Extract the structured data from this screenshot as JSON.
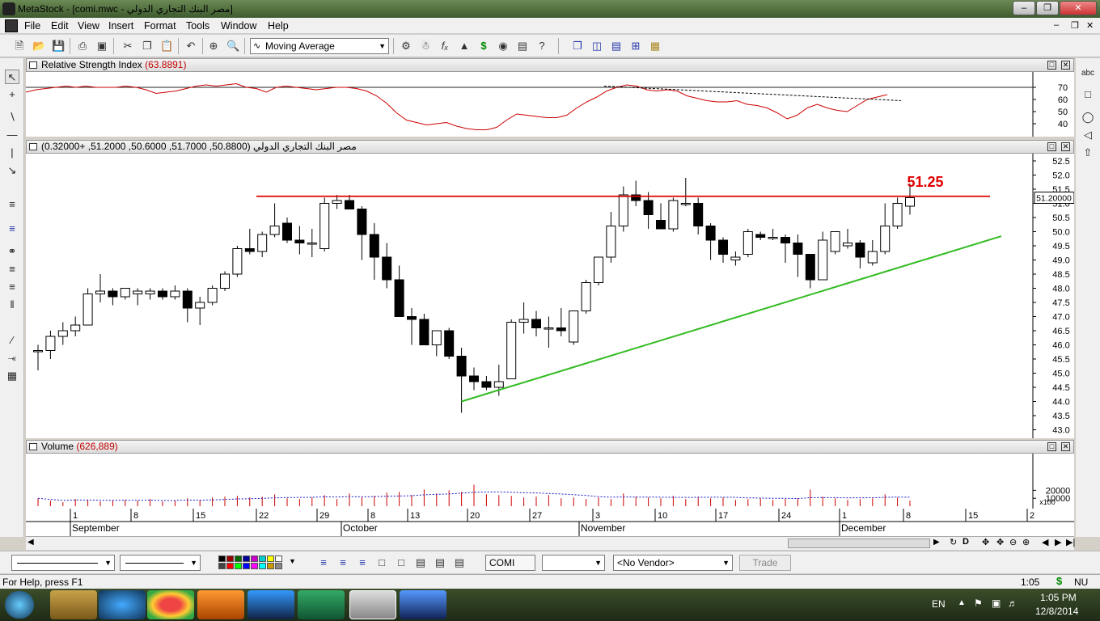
{
  "window": {
    "app_title": "MetaStock - [comi.mwc - مصر  البنك التجاري الدولي]"
  },
  "menu": [
    "File",
    "Edit",
    "View",
    "Insert",
    "Format",
    "Tools",
    "Window",
    "Help"
  ],
  "toolbar": {
    "indicator_select": "Moving Average",
    "icons": [
      "new-icon",
      "open-icon",
      "save-icon",
      "print-icon",
      "print-preview-icon",
      "cut-icon",
      "copy-icon",
      "paste-icon",
      "undo-icon",
      "crosshair-icon",
      "zoom-icon"
    ]
  },
  "rsi_panel": {
    "title": "Relative Strength Index",
    "value": "(63.8891)",
    "ticks": [
      "70",
      "60",
      "50",
      "40"
    ],
    "series_values": [
      66,
      68,
      69,
      70,
      71,
      70,
      71,
      70,
      70,
      70,
      71,
      70,
      68,
      65,
      66,
      67,
      69,
      71,
      72,
      71,
      72,
      73,
      70,
      69,
      66,
      70,
      71,
      70,
      69,
      68,
      69,
      70,
      70,
      69,
      67,
      63,
      57,
      49,
      43,
      41,
      39,
      40,
      41,
      38,
      36,
      35,
      35,
      37,
      43,
      48,
      47,
      46,
      45,
      45,
      47,
      53,
      58,
      62,
      67,
      70,
      72,
      71,
      68,
      67,
      68,
      67,
      63,
      61,
      59,
      58,
      58,
      59,
      56,
      55,
      53,
      49,
      44,
      47,
      53,
      56,
      53,
      51,
      50,
      55,
      60,
      62,
      64
    ]
  },
  "price_panel": {
    "title": "مصر  البنك التجاري الدولي",
    "ohlc_text": "(50.8800, 51.7000, 50.6000, 51.2000, +0.32000)",
    "current_price": "51.20000",
    "resistance_label": "51.25",
    "ticks": [
      "52.5",
      "52.0",
      "51.5",
      "51.0",
      "50.5",
      "50.0",
      "49.5",
      "49.0",
      "48.5",
      "48.0",
      "47.5",
      "47.0",
      "46.5",
      "46.0",
      "45.5",
      "45.0",
      "44.5",
      "44.0",
      "43.5",
      "43.0"
    ],
    "candles": [
      [
        45.8,
        46.0,
        45.1,
        45.8
      ],
      [
        45.8,
        46.5,
        45.5,
        46.3
      ],
      [
        46.3,
        46.8,
        46.0,
        46.5
      ],
      [
        46.5,
        47.0,
        46.3,
        46.7
      ],
      [
        46.7,
        48.0,
        46.7,
        47.8
      ],
      [
        47.8,
        48.5,
        47.5,
        47.9
      ],
      [
        47.9,
        48.0,
        47.4,
        47.7
      ],
      [
        47.7,
        48.0,
        47.6,
        48.0
      ],
      [
        47.8,
        48.0,
        47.4,
        47.9
      ],
      [
        47.8,
        48.0,
        47.6,
        47.9
      ],
      [
        47.9,
        48.0,
        47.6,
        47.7
      ],
      [
        47.7,
        48.1,
        47.6,
        47.9
      ],
      [
        47.9,
        48.0,
        46.8,
        47.3
      ],
      [
        47.3,
        47.7,
        46.7,
        47.5
      ],
      [
        47.5,
        48.1,
        47.4,
        48.0
      ],
      [
        48.0,
        48.6,
        47.9,
        48.5
      ],
      [
        48.5,
        49.5,
        48.4,
        49.4
      ],
      [
        49.4,
        50.1,
        49.2,
        49.3
      ],
      [
        49.3,
        50.0,
        49.1,
        49.9
      ],
      [
        49.9,
        51.0,
        49.8,
        50.2
      ],
      [
        50.3,
        50.5,
        49.6,
        49.7
      ],
      [
        49.7,
        50.2,
        49.2,
        49.6
      ],
      [
        49.6,
        50.1,
        49.1,
        49.6
      ],
      [
        49.4,
        51.2,
        49.3,
        51.0
      ],
      [
        51.0,
        51.3,
        50.8,
        51.1
      ],
      [
        51.1,
        51.3,
        50.8,
        50.8
      ],
      [
        50.8,
        50.9,
        49.0,
        49.9
      ],
      [
        49.9,
        50.3,
        48.3,
        49.1
      ],
      [
        49.1,
        49.6,
        48.0,
        48.3
      ],
      [
        48.3,
        48.8,
        47.0,
        47.0
      ],
      [
        47.0,
        47.3,
        46.0,
        46.9
      ],
      [
        46.9,
        47.1,
        46.0,
        46.0
      ],
      [
        46.0,
        46.5,
        45.6,
        46.5
      ],
      [
        46.5,
        46.6,
        45.5,
        45.6
      ],
      [
        45.6,
        45.9,
        43.6,
        44.9
      ],
      [
        44.9,
        45.2,
        44.4,
        44.7
      ],
      [
        44.7,
        44.9,
        44.4,
        44.5
      ],
      [
        44.5,
        45.3,
        44.2,
        44.7
      ],
      [
        44.8,
        46.9,
        44.8,
        46.8
      ],
      [
        46.8,
        47.5,
        46.4,
        46.9
      ],
      [
        46.9,
        47.2,
        46.3,
        46.6
      ],
      [
        46.6,
        47.0,
        45.9,
        46.6
      ],
      [
        46.6,
        47.3,
        46.3,
        46.5
      ],
      [
        46.1,
        47.2,
        46.0,
        47.2
      ],
      [
        47.2,
        48.3,
        47.1,
        48.2
      ],
      [
        48.2,
        49.0,
        48.1,
        49.1
      ],
      [
        49.1,
        50.7,
        48.9,
        50.2
      ],
      [
        50.2,
        51.6,
        50.0,
        51.3
      ],
      [
        51.3,
        51.8,
        50.9,
        51.1
      ],
      [
        51.1,
        51.4,
        50.1,
        50.6
      ],
      [
        50.4,
        51.0,
        50.2,
        50.1
      ],
      [
        50.1,
        51.2,
        50.0,
        51.1
      ],
      [
        51.0,
        51.9,
        50.9,
        51.0
      ],
      [
        51.0,
        51.2,
        49.9,
        50.2
      ],
      [
        50.2,
        50.3,
        49.0,
        49.7
      ],
      [
        49.7,
        49.8,
        48.9,
        49.2
      ],
      [
        49.0,
        49.3,
        48.8,
        49.1
      ],
      [
        49.2,
        50.1,
        49.1,
        50.0
      ],
      [
        49.9,
        50.0,
        49.7,
        49.8
      ],
      [
        49.8,
        50.1,
        49.7,
        49.8
      ],
      [
        49.8,
        49.9,
        48.9,
        49.6
      ],
      [
        49.6,
        49.9,
        48.4,
        49.2
      ],
      [
        49.2,
        49.2,
        48.0,
        48.3
      ],
      [
        48.3,
        50.0,
        48.3,
        49.7
      ],
      [
        49.3,
        50.0,
        49.2,
        50.0
      ],
      [
        49.5,
        50.1,
        49.4,
        49.6
      ],
      [
        49.6,
        49.7,
        48.7,
        49.1
      ],
      [
        48.9,
        49.7,
        48.8,
        49.3
      ],
      [
        49.3,
        51.0,
        49.2,
        50.2
      ],
      [
        50.2,
        51.2,
        50.1,
        51.0
      ],
      [
        50.9,
        51.7,
        50.6,
        51.2
      ]
    ],
    "resistance_y": 51.25,
    "support_from": [
      44.0,
      34
    ],
    "support_to": [
      50.2,
      80
    ]
  },
  "volume_panel": {
    "title": "Volume",
    "value": "(626,889)",
    "ticks": [
      "20000",
      "10000"
    ],
    "x100_label": "x100"
  },
  "time_axis": {
    "days": [
      "1",
      "8",
      "15",
      "22",
      "29",
      "8",
      "13",
      "20",
      "27",
      "3",
      "10",
      "17",
      "24",
      "1",
      "8",
      "15",
      "2"
    ],
    "months": [
      "September",
      "October",
      "November",
      "December"
    ]
  },
  "bottom_bar": {
    "symbol": "COMI",
    "vendor": "<No Vendor>",
    "trade_label": "Trade"
  },
  "status": {
    "help_text": "For Help, press F1",
    "time": "1:05",
    "mode": "NU"
  },
  "taskbar": {
    "lang": "EN",
    "clock_time": "1:05 PM",
    "clock_date": "12/8/2014"
  },
  "colors": {
    "up_candle": "#ffffff",
    "down_candle": "#000000",
    "rsi_line": "#cc0000",
    "resistance_line": "#e00000",
    "support_line": "#33bb22",
    "volume_bar": "#cc0000"
  }
}
